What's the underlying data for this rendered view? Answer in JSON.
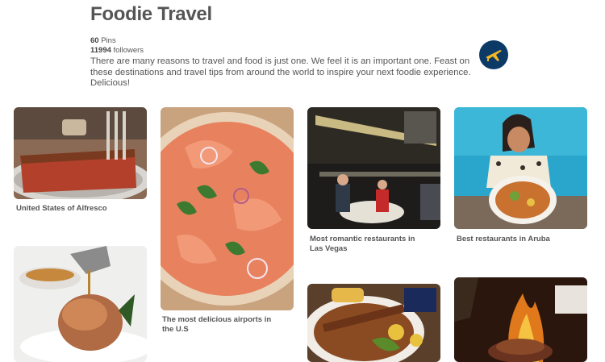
{
  "board": {
    "title": "Foodie Travel",
    "pins_count": "60",
    "pins_label": "Pins",
    "followers_count": "11994",
    "followers_label": "followers",
    "description": "There are many reasons to travel and food is just one. We feel it is an important one. Feast on these destinations and travel tips from around the world to inspire your next foodie experience. Delicious!",
    "logo_icon": "airplane-globe-icon",
    "logo_color": "#0b3a66"
  },
  "pins": [
    {
      "caption": "United States of Alfresco",
      "icon": "pizza-photo"
    },
    {
      "caption": "The most delicious airports in the U.S",
      "icon": "salmon-pizza-photo"
    },
    {
      "caption": "Most romantic restaurants in Las Vegas",
      "icon": "restaurant-photo"
    },
    {
      "caption": "Best restaurants in Aruba",
      "icon": "woman-plate-photo"
    },
    {
      "caption": "",
      "icon": "roast-chicken-photo"
    },
    {
      "caption": "",
      "icon": "skewer-plate-photo"
    },
    {
      "caption": "",
      "icon": "flaming-meat-photo"
    }
  ]
}
